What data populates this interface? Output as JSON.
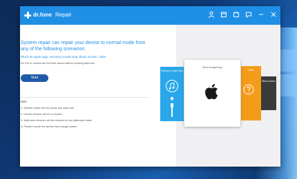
{
  "app": {
    "brand": "dr.fone",
    "separator": "·",
    "module": "Repair"
  },
  "toolbar_icons": [
    "user-icon",
    "cart-icon",
    "calendar-icon",
    "chat-icon",
    "minimize-icon",
    "close-icon"
  ],
  "main": {
    "headline": "System repair can repair your devise to normal mode from any of the following scenarios:",
    "scenario_line": "Stuck at Apple logo, recovery mode loop, black screen, other",
    "description": "Fix iOS to normal can fix these issues without causing data loss.",
    "start_label": "Start"
  },
  "notes": {
    "title": "Note",
    "items": [
      "1. System repair will not cause any data loss.",
      "2. Unlock devices will be re-locked.",
      "3. Jailbroken devices will be restored to non jailbroken state.",
      "4. Please ensure the device has enough power."
    ]
  },
  "cards": {
    "blue_label": "Recovery mode loop",
    "white_label": "Stuck at apple logo",
    "orange_label": "Other",
    "dark_label": "Black screen"
  },
  "colors": {
    "accent": "#1f8fe6",
    "start_button": "#1f5aa8",
    "card_blue": "#29a7ea",
    "card_orange": "#f59b1a",
    "card_dark": "#3a3a3a"
  }
}
